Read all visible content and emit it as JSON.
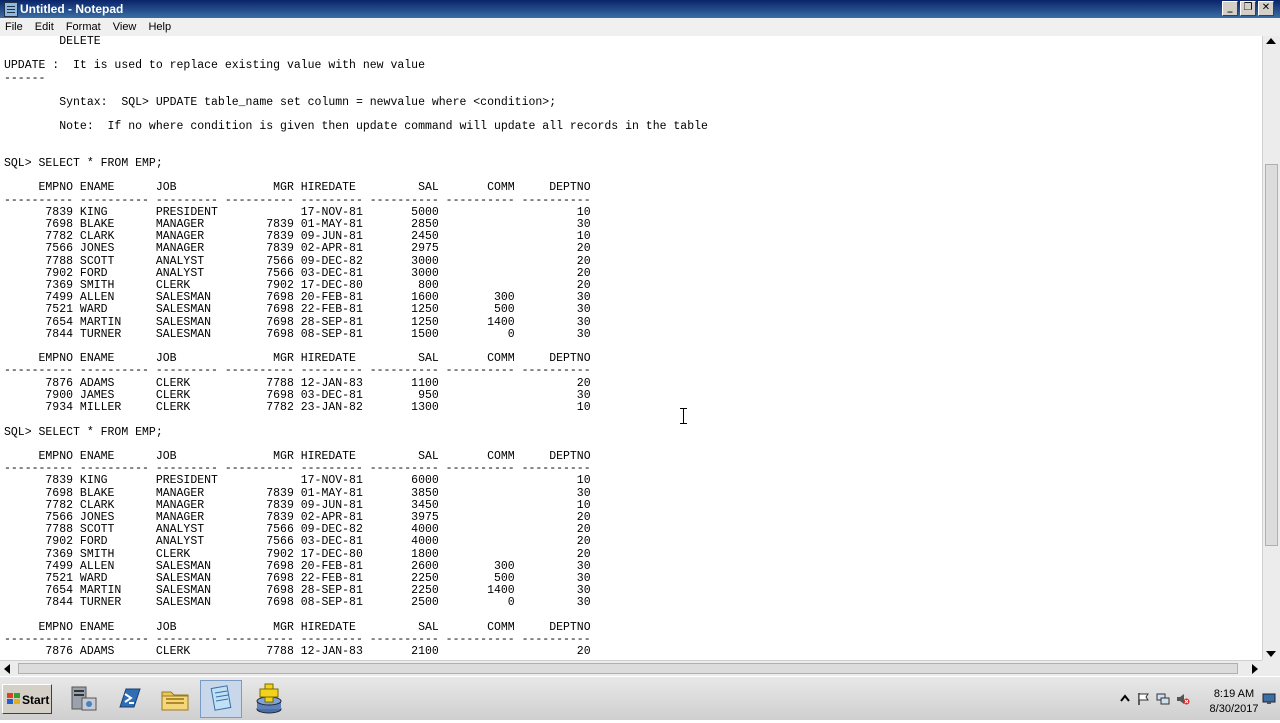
{
  "window": {
    "title": "Untitled - Notepad",
    "buttons": [
      "_",
      "❐",
      "✕"
    ]
  },
  "menu": [
    "File",
    "Edit",
    "Format",
    "View",
    "Help"
  ],
  "editor": {
    "lines": [
      "        DELETE",
      "",
      "UPDATE :  It is used to replace existing value with new value",
      "------",
      "",
      "        Syntax:  SQL> UPDATE table_name set column = newvalue where <condition>;",
      "",
      "        Note:  If no where condition is given then update command will update all records in the table",
      "",
      "",
      "SQL> SELECT * FROM EMP;",
      "",
      "     EMPNO ENAME      JOB              MGR HIREDATE         SAL       COMM     DEPTNO",
      "---------- ---------- --------- ---------- --------- ---------- ---------- ----------",
      "      7839 KING       PRESIDENT            17-NOV-81       5000                    10",
      "      7698 BLAKE      MANAGER         7839 01-MAY-81       2850                    30",
      "      7782 CLARK      MANAGER         7839 09-JUN-81       2450                    10",
      "      7566 JONES      MANAGER         7839 02-APR-81       2975                    20",
      "      7788 SCOTT      ANALYST         7566 09-DEC-82       3000                    20",
      "      7902 FORD       ANALYST         7566 03-DEC-81       3000                    20",
      "      7369 SMITH      CLERK           7902 17-DEC-80        800                    20",
      "      7499 ALLEN      SALESMAN        7698 20-FEB-81       1600        300         30",
      "      7521 WARD       SALESMAN        7698 22-FEB-81       1250        500         30",
      "      7654 MARTIN     SALESMAN        7698 28-SEP-81       1250       1400         30",
      "      7844 TURNER     SALESMAN        7698 08-SEP-81       1500          0         30",
      "",
      "     EMPNO ENAME      JOB              MGR HIREDATE         SAL       COMM     DEPTNO",
      "---------- ---------- --------- ---------- --------- ---------- ---------- ----------",
      "      7876 ADAMS      CLERK           7788 12-JAN-83       1100                    20",
      "      7900 JAMES      CLERK           7698 03-DEC-81        950                    30",
      "      7934 MILLER     CLERK           7782 23-JAN-82       1300                    10",
      "",
      "SQL> SELECT * FROM EMP;",
      "",
      "     EMPNO ENAME      JOB              MGR HIREDATE         SAL       COMM     DEPTNO",
      "---------- ---------- --------- ---------- --------- ---------- ---------- ----------",
      "      7839 KING       PRESIDENT            17-NOV-81       6000                    10",
      "      7698 BLAKE      MANAGER         7839 01-MAY-81       3850                    30",
      "      7782 CLARK      MANAGER         7839 09-JUN-81       3450                    10",
      "      7566 JONES      MANAGER         7839 02-APR-81       3975                    20",
      "      7788 SCOTT      ANALYST         7566 09-DEC-82       4000                    20",
      "      7902 FORD       ANALYST         7566 03-DEC-81       4000                    20",
      "      7369 SMITH      CLERK           7902 17-DEC-80       1800                    20",
      "      7499 ALLEN      SALESMAN        7698 20-FEB-81       2600        300         30",
      "      7521 WARD       SALESMAN        7698 22-FEB-81       2250        500         30",
      "      7654 MARTIN     SALESMAN        7698 28-SEP-81       2250       1400         30",
      "      7844 TURNER     SALESMAN        7698 08-SEP-81       2500          0         30",
      "",
      "     EMPNO ENAME      JOB              MGR HIREDATE         SAL       COMM     DEPTNO",
      "---------- ---------- --------- ---------- --------- ---------- ---------- ----------",
      "      7876 ADAMS      CLERK           7788 12-JAN-83       2100                    20"
    ]
  },
  "taskbar": {
    "start_label": "Start",
    "apps": [
      "server-manager-icon",
      "powershell-icon",
      "file-explorer-icon",
      "notepad-icon",
      "database-install-icon"
    ],
    "clock": {
      "time": "8:19 AM",
      "date": "8/30/2017"
    },
    "tray_icons": [
      "show-hidden-icon",
      "flag-icon",
      "network-icon",
      "speaker-muted-icon",
      "desktop-icon"
    ]
  }
}
